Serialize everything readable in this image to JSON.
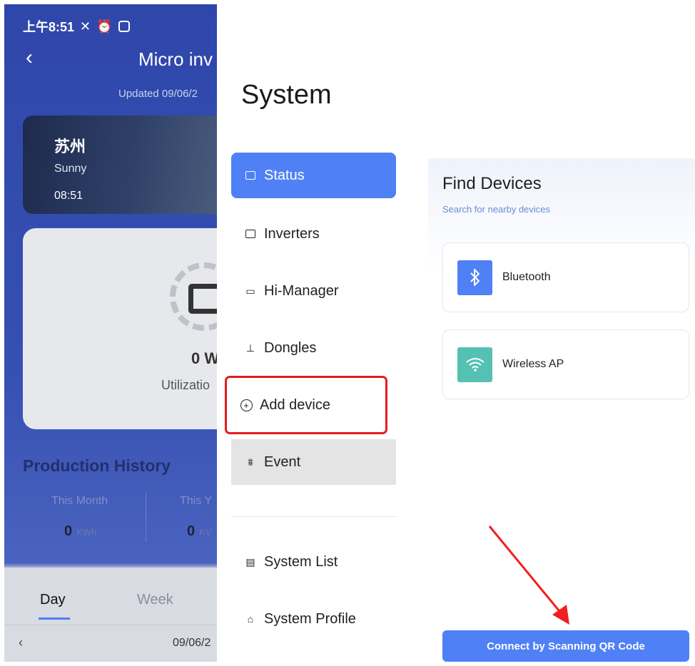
{
  "phone": {
    "status_time": "上午8:51",
    "title": "Micro inv",
    "updated": "Updated 09/06/2",
    "weather": {
      "city": "苏州",
      "condition": "Sunny",
      "time": "08:51"
    },
    "power": {
      "value": "0 W",
      "label": "Utilizatio"
    },
    "production": {
      "title": "Production History",
      "this_month_label": "This Month",
      "this_month_value": "0",
      "this_month_unit": "KWh",
      "this_year_label": "This Y",
      "this_year_value": "0",
      "this_year_unit": "KV"
    },
    "tabs": {
      "day": "Day",
      "week": "Week"
    },
    "date": "09/06/2"
  },
  "drawer": {
    "heading": "System",
    "items": [
      {
        "label": "Status"
      },
      {
        "label": "Inverters"
      },
      {
        "label": "Hi-Manager"
      },
      {
        "label": "Dongles"
      },
      {
        "label": "Add device"
      },
      {
        "label": "Event"
      },
      {
        "label": "System List"
      },
      {
        "label": "System Profile"
      }
    ]
  },
  "panel": {
    "title": "Find Devices",
    "subtitle": "Search for nearby devices",
    "devices": [
      {
        "label": "Bluetooth",
        "color": "#4f80f5",
        "icon": "bluetooth-icon"
      },
      {
        "label": "Wireless AP",
        "color": "#55c1b2",
        "icon": "wifi-icon"
      }
    ],
    "qr_button": "Connect by Scanning QR Code"
  },
  "colors": {
    "accent": "#4f80f5",
    "highlight": "#e41d1d",
    "wifi": "#55c1b2"
  }
}
